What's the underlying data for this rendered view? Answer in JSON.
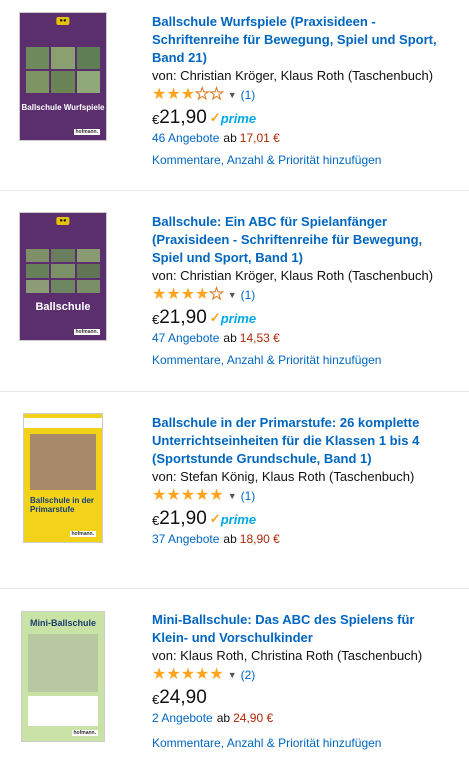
{
  "items": [
    {
      "title": "Ballschule Wurfspiele (Praxisideen - Schriftenreihe für Bewegung, Spiel und Sport, Band 21)",
      "byline": "von: Christian Kröger, Klaus Roth (Taschenbuch)",
      "stars_filled": 3,
      "stars_total": 5,
      "rating_count": "(1)",
      "currency": "€",
      "price": "21,90",
      "prime": "prime",
      "offers": "46 Angebote",
      "ab": "ab",
      "lowest": "17,01 €",
      "action": "Kommentare, Anzahl & Priorität hinzufügen",
      "cover": {
        "bg": "#5b2e6e",
        "title": "Ballschule Wurfspiele",
        "badge": "",
        "pub": "hofmann."
      }
    },
    {
      "title": "Ballschule: Ein ABC für Spielanfänger (Praxisideen - Schriftenreihe für Bewegung, Spiel und Sport, Band 1)",
      "byline": "von: Christian Kröger, Klaus Roth (Taschenbuch)",
      "stars_filled": 4,
      "stars_total": 5,
      "rating_count": "(1)",
      "currency": "€",
      "price": "21,90",
      "prime": "prime",
      "offers": "47 Angebote",
      "ab": "ab",
      "lowest": "14,53 €",
      "action": "Kommentare, Anzahl & Priorität hinzufügen",
      "cover": {
        "bg": "#5b2e6e",
        "title": "Ballschule",
        "badge": "",
        "pub": "hofmann."
      }
    },
    {
      "title": "Ballschule in der Primarstufe: 26 komplette Unterrichtseinheiten für die Klassen 1 bis 4 (Sportstunde Grundschule, Band 1)",
      "byline": "von: Stefan König, Klaus Roth (Taschenbuch)",
      "stars_filled": 5,
      "stars_total": 5,
      "rating_count": "(1)",
      "currency": "€",
      "price": "21,90",
      "prime": "prime",
      "offers": "37 Angebote",
      "ab": "ab",
      "lowest": "18,90 €",
      "action": "",
      "cover": {
        "bg": "#f3d21a",
        "title": "Ballschule in der Primarstufe",
        "badge": "",
        "pub": "hofmann."
      }
    },
    {
      "title": "Mini-Ballschule: Das ABC des Spielens für Klein- und Vorschulkinder",
      "byline": "von: Klaus Roth, Christina Roth (Taschenbuch)",
      "stars_filled": 5,
      "stars_total": 5,
      "rating_count": "(2)",
      "currency": "€",
      "price": "24,90",
      "prime": "",
      "offers": "2 Angebote",
      "ab": "ab",
      "lowest": "24,90 €",
      "action": "Kommentare, Anzahl & Priorität hinzufügen",
      "cover": {
        "bg": "#c9e3a6",
        "title": "Mini-Ballschule",
        "badge": "",
        "pub": "hofmann."
      }
    }
  ]
}
